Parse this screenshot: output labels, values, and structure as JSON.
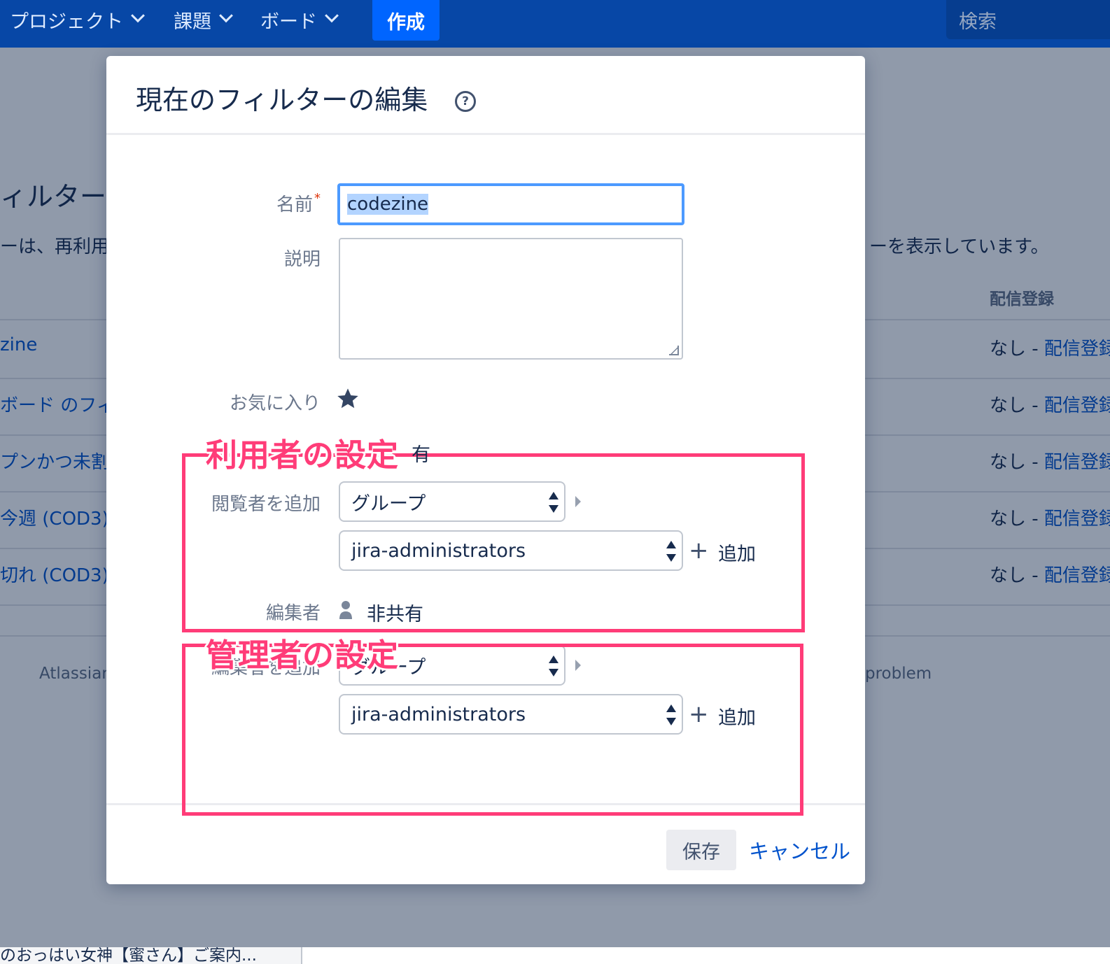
{
  "nav": {
    "items": [
      "プロジェクト",
      "課題",
      "ボード"
    ],
    "create": "作成",
    "search_placeholder": "検索"
  },
  "background": {
    "title": "ィルター",
    "desc_left": "ーは、再利用",
    "desc_right": "ーを表示しています。",
    "col_header": "配信登録",
    "rows": [
      {
        "name": "zine",
        "sub_prefix": "なし - ",
        "sub_link": "配信登録"
      },
      {
        "name": "ボード のフィ",
        "sub_prefix": "なし - ",
        "sub_link": "配信登録"
      },
      {
        "name": "プンかつ未割",
        "sub_prefix": "なし - ",
        "sub_link": "配信登録"
      },
      {
        "name": "今週 (COD3)",
        "sub_prefix": "なし - ",
        "sub_link": "配信登録"
      },
      {
        "name": "切れ (COD3)",
        "sub_prefix": "なし - ",
        "sub_link": "配信登録"
      }
    ],
    "footer_left": "Atlassian",
    "footer_right": "problem",
    "bottom_tab": "のおっはい女神【蜜さん】ご案内..."
  },
  "dialog": {
    "title": "現在のフィルターの編集",
    "help_glyph": "?",
    "name_label": "名前",
    "required_mark": "*",
    "name_value": "codezine",
    "desc_label": "説明",
    "favorite_label": "お気に入り",
    "viewers_label": "閲覧者を追加",
    "viewers_type": "グループ",
    "viewers_group": "jira-administrators",
    "add_label": "追加",
    "add_glyph": "+",
    "editors_label": "編集者",
    "editors_status": "非共有",
    "add_editors_label": "編集者を追加",
    "editors_type": "グループ",
    "editors_group": "jira-administrators",
    "save": "保存",
    "cancel": "キャンセル"
  },
  "annotations": {
    "users_setting": "利用者の設定",
    "users_hidden_text": "有",
    "admins_setting": "管理者の設定"
  },
  "colors": {
    "nav_bg": "#0747a6",
    "accent_pink": "#ff3c78",
    "link_blue": "#0052cc"
  }
}
